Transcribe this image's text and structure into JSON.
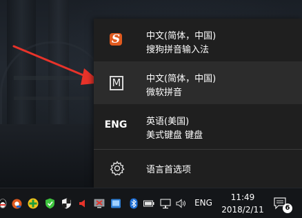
{
  "language_flyout": {
    "items": [
      {
        "icon": "sogou-icon",
        "icon_text": "S",
        "line1": "中文(简体，中国)",
        "line2": "搜狗拼音输入法",
        "selected": false
      },
      {
        "icon": "m-icon",
        "icon_text": "M",
        "line1": "中文(简体，中国)",
        "line2": "微软拼音",
        "selected": true
      },
      {
        "icon": "eng-icon",
        "icon_text": "ENG",
        "line1": "英语(美国)",
        "line2": "美式键盘 键盘",
        "selected": false
      }
    ],
    "preferences_label": "语言首选项",
    "preferences_icon": "gear-icon"
  },
  "taskbar": {
    "tray_icons": [
      "qq-icon",
      "sogou-tray-icon",
      "green-plus-icon",
      "shield-icon",
      "security-shield-icon",
      "volume-warning-icon",
      "network-warning-icon",
      "display-icon",
      "bluetooth-icon",
      "battery-icon",
      "network-icon",
      "speaker-icon"
    ],
    "language_indicator": "ENG",
    "time": "11:49",
    "date": "2018/2/11",
    "notification_count": "6"
  },
  "colors": {
    "flyout_bg": "#1f1f1f",
    "selected_bg": "#2c2c2c",
    "arrow": "#e8332a",
    "sogou_orange": "#e05a1f",
    "taskbar_bg": "#141619"
  }
}
